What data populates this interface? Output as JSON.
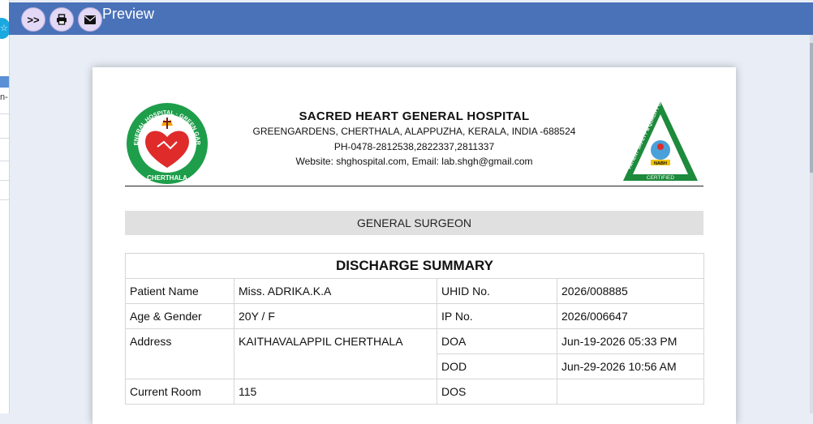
{
  "toolbar": {
    "expand_label": ">>",
    "print_icon": "print-icon",
    "email_icon": "envelope-icon",
    "title": "Preview"
  },
  "left_app": {
    "fragment_text": "n-",
    "star_icon": "star-icon"
  },
  "logo_left": {
    "ring_top": "S.H.GENERAL HOSPITAL · GREEN GARDENS",
    "ring_bottom": "CHERTHALA"
  },
  "logo_right": {
    "side_text": "PATIENT SAFETY & QUALITY OF CARE",
    "acronym": "NABH",
    "certified": "CERTIFIED"
  },
  "hospital": {
    "name": "SACRED HEART GENERAL HOSPITAL",
    "address": "GREENGARDENS, CHERTHALA, ALAPPUZHA, KERALA, INDIA -688524",
    "phone": "PH-0478-2812538,2822337,2811337",
    "web": "Website: shghospital.com, Email: lab.shgh@gmail.com"
  },
  "department": "GENERAL SURGEON",
  "summary": {
    "title": "DISCHARGE SUMMARY",
    "patient_name_label": "Patient Name",
    "patient_name": "Miss. ADRIKA.K.A",
    "uhid_label": "UHID No.",
    "uhid": "2026/008885",
    "age_gender_label": "Age & Gender",
    "age_gender": "20Y / F",
    "ip_label": "IP No.",
    "ip": "2026/006647",
    "address_label": "Address",
    "address": "KAITHAVALAPPIL CHERTHALA",
    "doa_label": "DOA",
    "doa": "Jun-19-2026 05:33 PM",
    "dod_label": "DOD",
    "dod": "Jun-29-2026 10:56 AM",
    "room_label": "Current Room",
    "room": "115",
    "dos_label": "DOS",
    "dos": ""
  },
  "colors": {
    "toolbar": "#4a72b8",
    "logo_green": "#1e9e4a",
    "logo_red": "#e02b2b",
    "nabh_green": "#1d8a3c"
  }
}
